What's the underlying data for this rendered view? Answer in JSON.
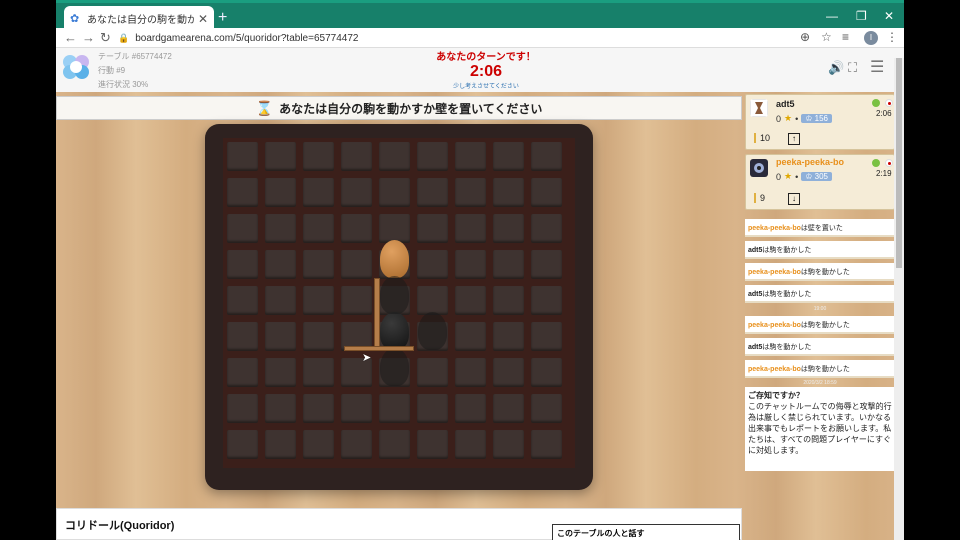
{
  "browser": {
    "tab_title": "あなたは自分の駒を動かすか壁を",
    "url": "boardgamearena.com/5/quoridor?table=65774472",
    "profile_initial": "I"
  },
  "header": {
    "table_label": "テーブル #65774472",
    "move_label": "行動 #9",
    "progress_label": "進行状況 30%",
    "turn_title": "あなたのターンです！",
    "timer": "2:06",
    "turn_sub": "少し考えさせてください"
  },
  "instruction": "あなたは自分の駒を動かすか壁を置いてください",
  "players": [
    {
      "name": "adt5",
      "name_color": "#222222",
      "score": "0",
      "elo": "156",
      "time": "2:06",
      "walls": "10",
      "arrow": "↑"
    },
    {
      "name": "peeka-peeka-bo",
      "name_color": "#e8901c",
      "score": "0",
      "elo": "305",
      "time": "2:19",
      "walls": "9",
      "arrow": "↓"
    }
  ],
  "log": [
    {
      "player": "peeka-peeka-bo",
      "text": "は壁を置いた",
      "color": "orange"
    },
    {
      "player": "adt5",
      "text": "は駒を動かした",
      "color": "black"
    },
    {
      "player": "peeka-peeka-bo",
      "text": "は駒を動かした",
      "color": "orange"
    },
    {
      "player": "adt5",
      "text": "は駒を動かした",
      "color": "black"
    },
    {
      "player": "peeka-peeka-bo",
      "text": "は駒を動かした",
      "color": "orange"
    },
    {
      "player": "adt5",
      "text": "は駒を動かした",
      "color": "black"
    },
    {
      "player": "peeka-peeka-bo",
      "text": "は駒を動かした",
      "color": "orange"
    }
  ],
  "timestamps": [
    "19:00",
    "2020/3/2 18:59"
  ],
  "tip": {
    "title": "ご存知ですか？",
    "body": "このチャットルームでの侮辱と攻撃的行為は厳しく禁じられています。いかなる出来事でもレポートをお願いします。私たちは、すべての問題プレイヤーにすぐに対処します。"
  },
  "bottom": {
    "game_title": "コリドール(Quoridor)",
    "chat_title": "このテーブルの人と話す"
  },
  "colors": {
    "accent": "#17806a",
    "timer": "#cc0000",
    "orange": "#e8901c"
  }
}
